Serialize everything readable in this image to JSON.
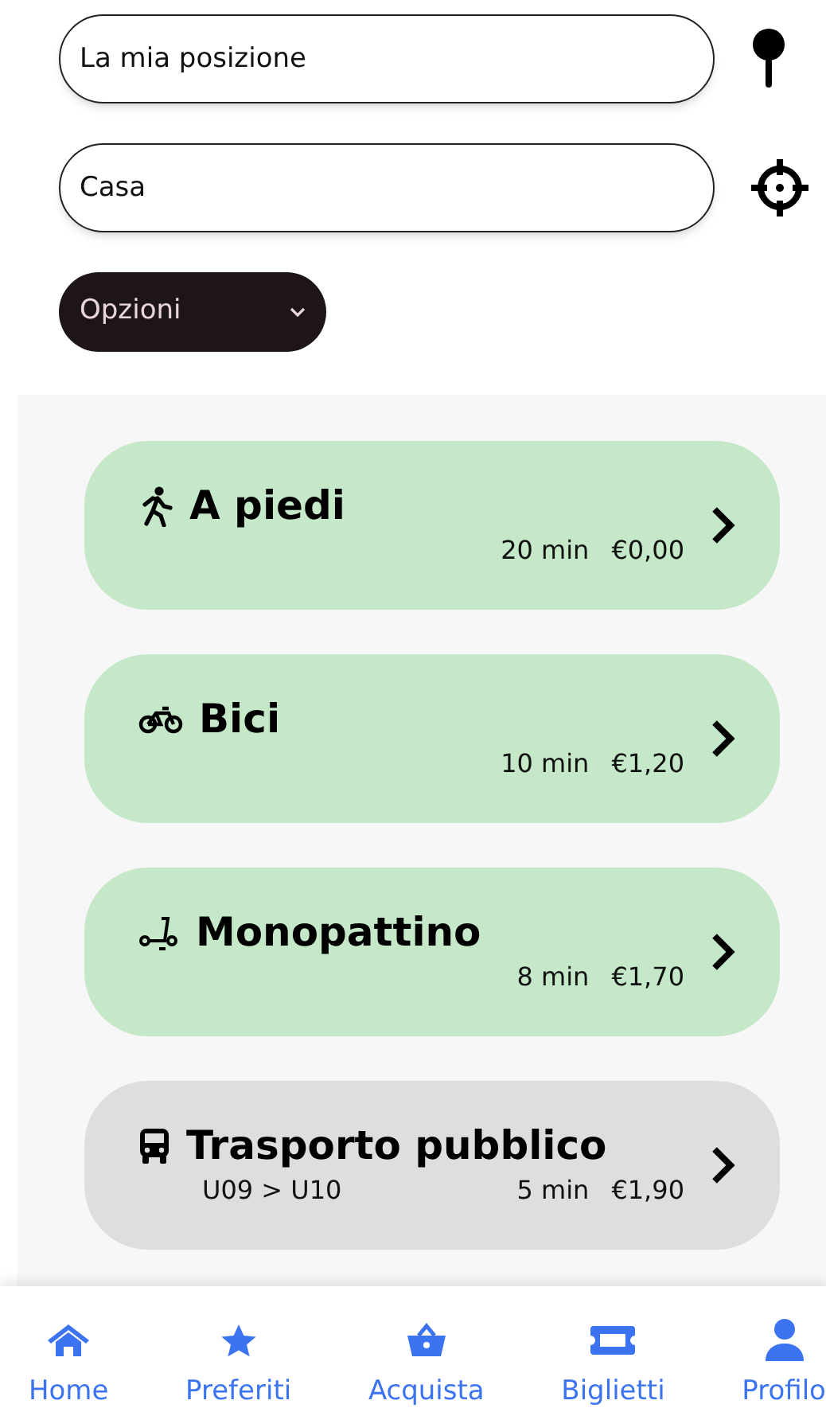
{
  "from_field": {
    "value": "La mia posizione"
  },
  "to_field": {
    "value": "Casa"
  },
  "options_button": {
    "label": "Opzioni"
  },
  "routes": [
    {
      "kind": "walk",
      "title": "A piedi",
      "duration": "20 min",
      "price": "€0,00",
      "color": "#c5e9c8"
    },
    {
      "kind": "bike",
      "title": "Bici",
      "duration": "10 min",
      "price": "€1,20",
      "color": "#c5e9c8"
    },
    {
      "kind": "scooter",
      "title": "Monopattino",
      "duration": "8 min",
      "price": "€1,70",
      "color": "#c5e9c8"
    },
    {
      "kind": "bus",
      "title": "Trasporto pubblico",
      "line": "U09 > U10",
      "duration": "5 min",
      "price": "€1,90",
      "color": "#dedede"
    }
  ],
  "nav": [
    {
      "kind": "home",
      "label": "Home"
    },
    {
      "kind": "star",
      "label": "Preferiti"
    },
    {
      "kind": "basket",
      "label": "Acquista"
    },
    {
      "kind": "ticket",
      "label": "Biglietti"
    },
    {
      "kind": "user",
      "label": "Profilo"
    }
  ]
}
